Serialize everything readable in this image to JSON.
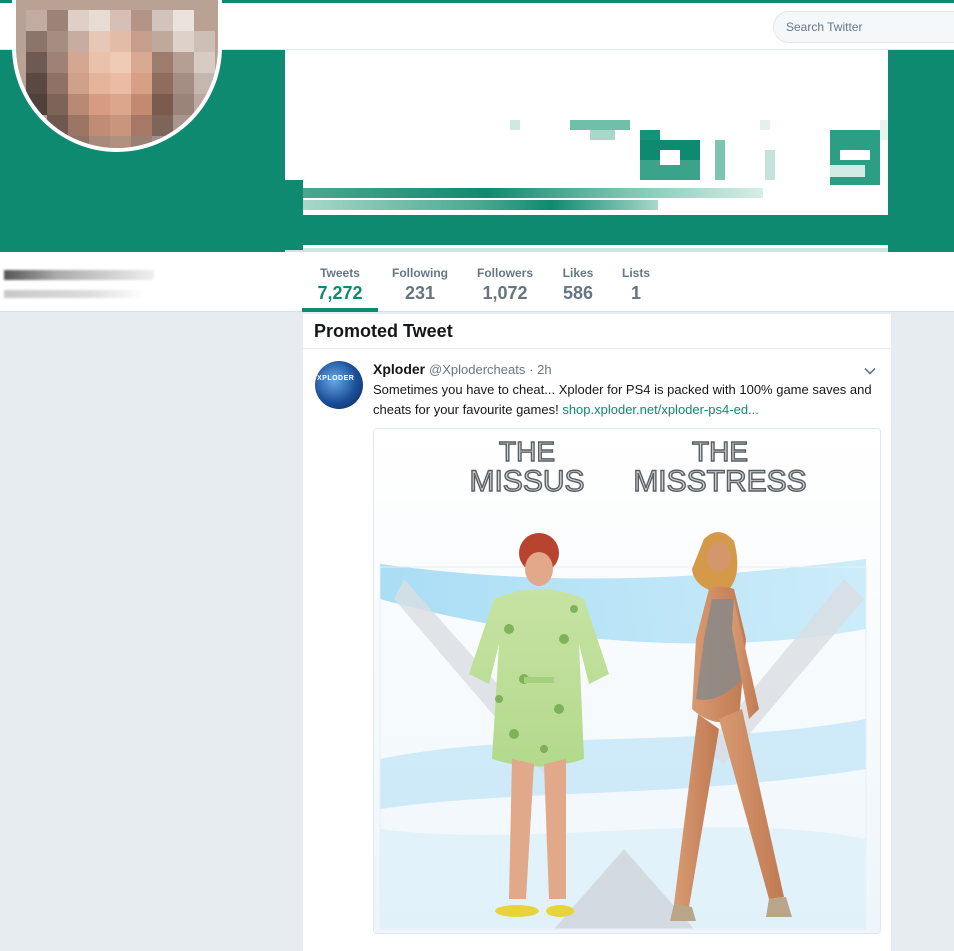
{
  "nav": {
    "search_placeholder": "Search Twitter",
    "brand_color": "#1da1f2"
  },
  "profile": {
    "accent_color": "#0e8a70",
    "stats": [
      {
        "label": "Tweets",
        "value": "7,272"
      },
      {
        "label": "Following",
        "value": "231"
      },
      {
        "label": "Followers",
        "value": "1,072"
      },
      {
        "label": "Likes",
        "value": "586"
      },
      {
        "label": "Lists",
        "value": "1"
      }
    ]
  },
  "timeline": {
    "section_title": "Promoted Tweet",
    "tweet": {
      "name": "Xploder",
      "handle": "@Xplodercheats",
      "time": "· 2h",
      "avatar_text": "XPLODER",
      "text": "Sometimes you have to cheat... Xploder for PS4 is packed with 100% game saves and cheats for your favourite games! ",
      "link": "shop.xploder.net/xploder-ps4-ed...",
      "media": {
        "left_line1": "THE",
        "left_line2": "MISSUS",
        "right_line1": "THE",
        "right_line2": "MISSTRESS"
      }
    }
  }
}
